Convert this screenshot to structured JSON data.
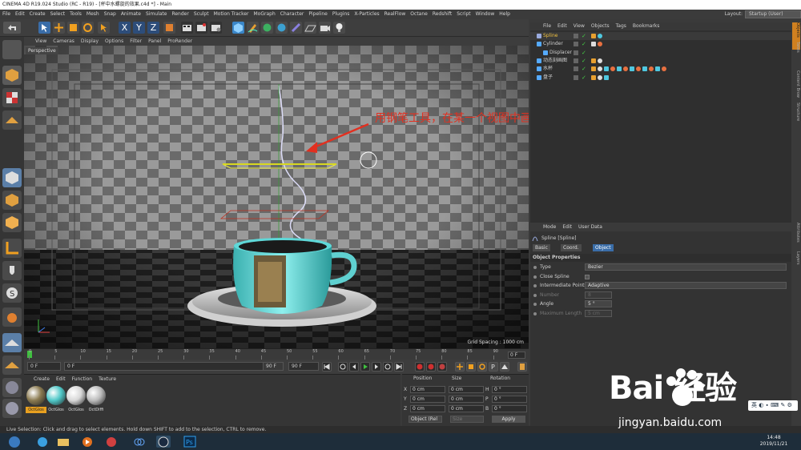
{
  "window": {
    "title": "CINEMA 4D R19.024 Studio (RC - R19) - [杯中水螺旋的效果.c4d *] - Main"
  },
  "menubar": {
    "items": [
      "File",
      "Edit",
      "Create",
      "Select",
      "Tools",
      "Mesh",
      "Snap",
      "Animate",
      "Simulate",
      "Render",
      "Sculpt",
      "Motion Tracker",
      "MoGraph",
      "Character",
      "Pipeline",
      "Plugins",
      "X-Particles",
      "RealFlow",
      "Octane",
      "Redshift",
      "Script",
      "Window",
      "Help"
    ]
  },
  "layout": {
    "label": "Layout:",
    "value": "Startup (User)"
  },
  "viewport": {
    "menu": [
      "View",
      "Cameras",
      "Display",
      "Options",
      "Filter",
      "Panel",
      "ProRender"
    ],
    "label": "Perspective",
    "grid_spacing": "Grid Spacing : 1000 cm",
    "annotation": "用钢笔工具，在某一个视图中画出螺旋状并调节。"
  },
  "timeline": {
    "ticks": [
      "0",
      "5",
      "10",
      "15",
      "20",
      "25",
      "30",
      "35",
      "40",
      "45",
      "50",
      "55",
      "60",
      "65",
      "70",
      "75",
      "80",
      "85",
      "90"
    ],
    "end_label": "0 F",
    "current_frame": "0 F",
    "start_field": "0 F",
    "end_field": "90 F",
    "end_field2": "90 F"
  },
  "material_manager": {
    "menu": [
      "Create",
      "Edit",
      "Function",
      "Texture"
    ],
    "materials": [
      {
        "label": "OctGlos",
        "color": "#8a7a50",
        "selected": true
      },
      {
        "label": "OctGlos",
        "color": "#4fc8c8",
        "selected": false
      },
      {
        "label": "OctGlos",
        "color": "#d8d8d8",
        "selected": false
      },
      {
        "label": "OctDiffi",
        "color": "#bcbcbc",
        "selected": false
      }
    ]
  },
  "coordinates": {
    "headers": {
      "position": "Position",
      "size": "Size",
      "rotation": "Rotation"
    },
    "rows": [
      {
        "axis": "X",
        "pos": "0 cm",
        "size": "0 cm",
        "rot_axis": "H",
        "rot": "0 °"
      },
      {
        "axis": "Y",
        "pos": "0 cm",
        "size": "0 cm",
        "rot_axis": "P",
        "rot": "0 °"
      },
      {
        "axis": "Z",
        "pos": "0 cm",
        "size": "0 cm",
        "rot_axis": "B",
        "rot": "0 °"
      }
    ],
    "mode": "Object (Rel",
    "size_mode": "Size",
    "apply": "Apply"
  },
  "object_manager": {
    "menu": [
      "File",
      "Edit",
      "View",
      "Objects",
      "Tags",
      "Bookmarks"
    ],
    "objects": [
      {
        "name": "Spline",
        "indent": 0,
        "color": "#f0c040"
      },
      {
        "name": "Cylinder",
        "indent": 0,
        "color": "#cfcfcf"
      },
      {
        "name": "Displacer",
        "indent": 1,
        "color": "#cfcfcf"
      },
      {
        "name": "动态刻画图",
        "indent": 0,
        "color": "#cfcfcf"
      },
      {
        "name": "水杯",
        "indent": 0,
        "color": "#cfcfcf"
      },
      {
        "name": "盘子",
        "indent": 0,
        "color": "#cfcfcf"
      }
    ]
  },
  "attributes": {
    "menu": [
      "Mode",
      "Edit",
      "User Data"
    ],
    "object_title": "Spline [Spline]",
    "tabs": [
      "Basic",
      "Coord.",
      "Object"
    ],
    "active_tab": "Object",
    "section": "Object Properties",
    "rows": [
      {
        "label": "Type",
        "value": "Bezier",
        "kind": "dropdown"
      },
      {
        "label": "Close Spline",
        "value": "",
        "kind": "checkbox"
      },
      {
        "label": "Intermediate Points",
        "value": "Adaptive",
        "kind": "dropdown"
      },
      {
        "label": "Number",
        "value": "8",
        "kind": "disabled"
      },
      {
        "label": "Angle",
        "value": "5 °",
        "kind": "field"
      },
      {
        "label": "Maximum Length",
        "value": "5 cm",
        "kind": "disabled"
      }
    ]
  },
  "right_tabs": [
    "Objects",
    "Takes",
    "Content Browser",
    "Structure",
    "Attributes",
    "Layers"
  ],
  "status": {
    "text": "Live Selection: Click and drag to select elements. Hold down SHIFT to add to the selection, CTRL to remove."
  },
  "watermark": {
    "logo": "Bai 经验",
    "site": "jingyan.baidu.com"
  },
  "ime": {
    "text": "英 ◐ ∙ ⌨ ✎ ⚙"
  },
  "clock": {
    "time": "14:48",
    "date": "2019/11/21"
  }
}
